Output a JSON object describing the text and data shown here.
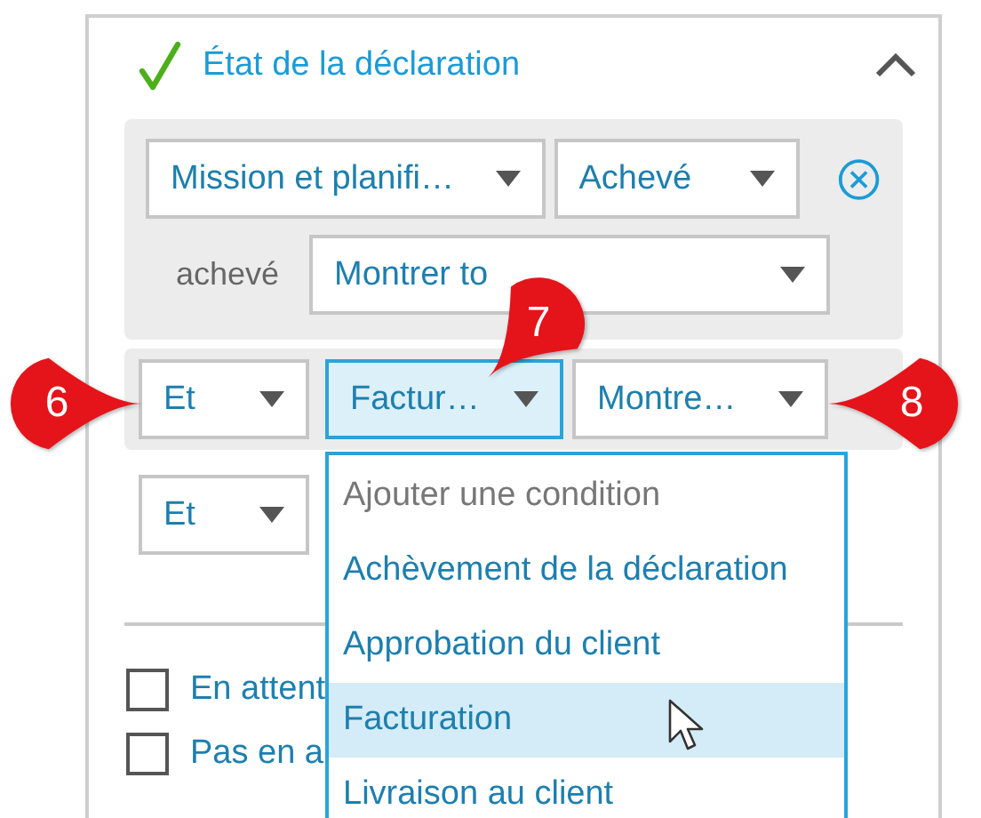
{
  "section": {
    "title": "État de la déclaration",
    "expanded": true
  },
  "condition_group": {
    "field": "Mission et planifi…",
    "status": "Achevé",
    "sub_label": "achevé",
    "sub_value": "Montrer to"
  },
  "condition_rows": [
    {
      "operator": "Et",
      "field": "Factur…",
      "value": "Montre…",
      "active": true,
      "shaded": true
    },
    {
      "operator": "Et",
      "shaded": false
    }
  ],
  "checkboxes": [
    {
      "label": "En attent",
      "checked": false
    },
    {
      "label": "Pas en a",
      "checked": false
    }
  ],
  "dropdown_menu": [
    {
      "label": "Ajouter une condition",
      "kind": "header",
      "selected": false
    },
    {
      "label": "Achèvement de la déclaration",
      "kind": "option",
      "selected": false
    },
    {
      "label": "Approbation du client",
      "kind": "option",
      "selected": false
    },
    {
      "label": "Facturation",
      "kind": "option",
      "selected": true
    },
    {
      "label": "Livraison au client",
      "kind": "option",
      "selected": false
    }
  ],
  "callouts": [
    {
      "number": "6"
    },
    {
      "number": "7"
    },
    {
      "number": "8"
    }
  ]
}
